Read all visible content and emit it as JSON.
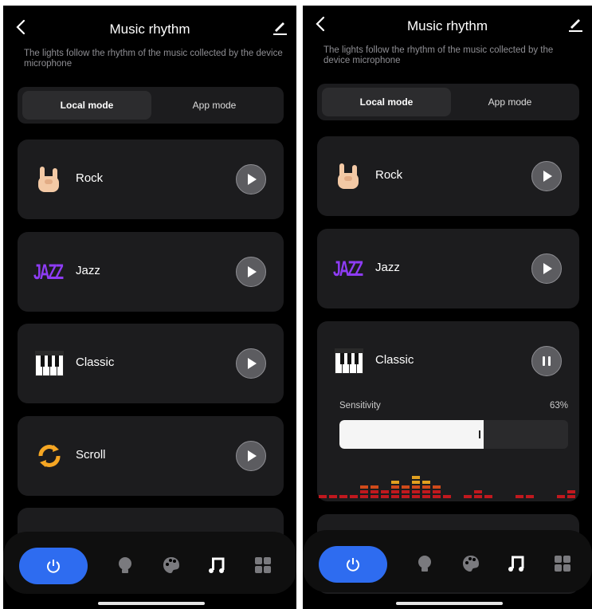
{
  "screen": {
    "title": "Music rhythm",
    "subtitle": "The lights follow the rhythm of the music collected by the device microphone",
    "modes": [
      "Local mode",
      "App mode"
    ]
  },
  "modes_list": [
    {
      "name": "Rock",
      "icon": "rock-hand-icon"
    },
    {
      "name": "Jazz",
      "icon": "jazz-logo-icon",
      "logo_text": "JAZZ"
    },
    {
      "name": "Classic",
      "icon": "piano-keys-icon"
    },
    {
      "name": "Scroll",
      "icon": "scroll-arrows-icon"
    }
  ],
  "sensitivity": {
    "label": "Sensitivity",
    "value_text": "63%",
    "value": 0.63
  },
  "nav": {
    "items": [
      "power-icon",
      "bulb-icon",
      "palette-icon",
      "music-note-icon",
      "grid-icon"
    ]
  },
  "colors": {
    "accent": "#2e6cf0",
    "jazz": "#8e3cf5",
    "scroll": "#f5a623",
    "background": "#000000",
    "card": "#1c1c1e"
  }
}
